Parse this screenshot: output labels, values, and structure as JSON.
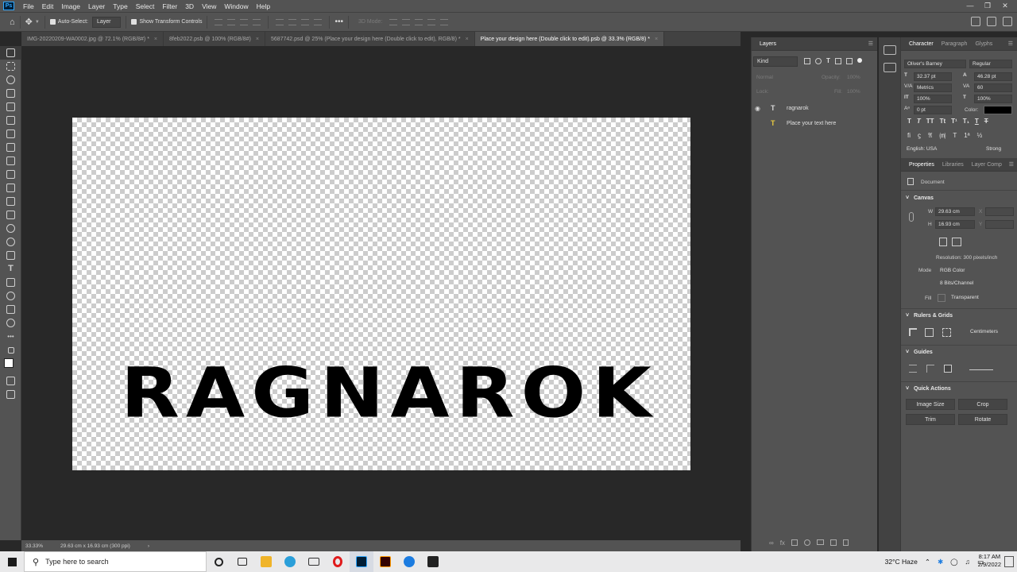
{
  "menubar": {
    "items": [
      "File",
      "Edit",
      "Image",
      "Layer",
      "Type",
      "Select",
      "Filter",
      "3D",
      "View",
      "Window",
      "Help"
    ]
  },
  "optionsbar": {
    "auto_select_label": "Auto-Select:",
    "auto_select_target": "Layer",
    "show_transform_label": "Show Transform Controls",
    "mode_3d": "3D Mode:"
  },
  "tabs": [
    {
      "label": "IMG-20220209-WA0002.jpg @ 72.1% (RGB/8#) *",
      "active": false
    },
    {
      "label": "8feb2022.psb @ 100% (RGB/8#)",
      "active": false
    },
    {
      "label": "5687742.psd @ 25% (Place your design here (Double click to edit), RGB/8) *",
      "active": false
    },
    {
      "label": "Place your design here (Double click to edit).psb @ 33.3% (RGB/8) *",
      "active": true
    }
  ],
  "canvas": {
    "text": "RAGNAROK"
  },
  "statusbar": {
    "zoom": "33.33%",
    "doc_size": "29.63 cm x 16.93 cm (300 ppi)"
  },
  "layers": {
    "title": "Layers",
    "filter": "Kind",
    "blend_mode": "Normal",
    "opacity_label": "Opacity:",
    "opacity_value": "100%",
    "lock_label": "Lock:",
    "fill_label": "Fill:",
    "fill_value": "100%",
    "items": [
      {
        "name": "ragnarok"
      },
      {
        "name": "Place your text here"
      }
    ]
  },
  "character": {
    "tabs": [
      "Character",
      "Paragraph",
      "Glyphs"
    ],
    "font_family": "Oliver's Barney",
    "font_style": "Regular",
    "font_size": "32.37 pt",
    "leading": "46.28 pt",
    "kerning": "Metrics",
    "tracking": "60",
    "vscale": "100%",
    "hscale": "100%",
    "baseline": "0 pt",
    "color_label": "Color:",
    "language": "English: USA",
    "antialias": "Strong",
    "color": "#000000"
  },
  "properties": {
    "tabs": [
      "Properties",
      "Libraries",
      "Layer Comp"
    ],
    "doc_label": "Document",
    "canvas_section": "Canvas",
    "w_label": "W",
    "w_value": "29.63 cm",
    "h_label": "H",
    "h_value": "16.93 cm",
    "x_label": "X",
    "y_label": "Y",
    "resolution": "Resolution: 300 pixels/inch",
    "mode_label": "Mode",
    "mode_value": "RGB Color",
    "bits_value": "8 Bits/Channel",
    "fill_label": "Fill",
    "fill_value": "Transparent",
    "rulers_section": "Rulers & Grids",
    "units": "Centimeters",
    "guides_section": "Guides",
    "quick_section": "Quick Actions",
    "btn_image_size": "Image Size",
    "btn_crop": "Crop",
    "btn_trim": "Trim",
    "btn_rotate": "Rotate"
  },
  "taskbar": {
    "search_placeholder": "Type here to search",
    "weather": "32°C  Haze",
    "time": "8:17 AM",
    "date": "2/9/2022"
  }
}
